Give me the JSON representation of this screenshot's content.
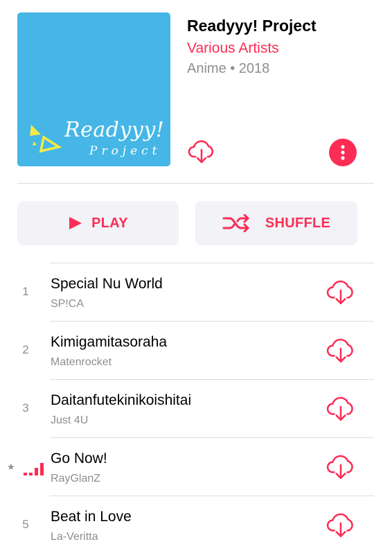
{
  "album": {
    "artwork": {
      "title": "Readyyy!",
      "subtitle": "Project",
      "background": "#45b6e6"
    },
    "title": "Readyyy! Project",
    "artist": "Various Artists",
    "meta": "Anime • 2018"
  },
  "colors": {
    "accent": "#fb2d55",
    "secondary_text": "#8e8e93",
    "button_bg": "#f2f2f7"
  },
  "actions": {
    "play_label": "PLAY",
    "shuffle_label": "SHUFFLE"
  },
  "tracks": [
    {
      "number": "1",
      "title": "Special Nu World",
      "artist": "SP!CA"
    },
    {
      "number": "2",
      "title": "Kimigamitasoraha",
      "artist": "Matenrocket"
    },
    {
      "number": "3",
      "title": "Daitanfutekinikoishitai",
      "artist": "Just 4U"
    },
    {
      "number": "",
      "title": "Go Now!",
      "artist": "RayGlanZ",
      "now_playing": true,
      "favorite_mark": "★"
    },
    {
      "number": "5",
      "title": "Beat in Love",
      "artist": "La-Veritta"
    }
  ]
}
